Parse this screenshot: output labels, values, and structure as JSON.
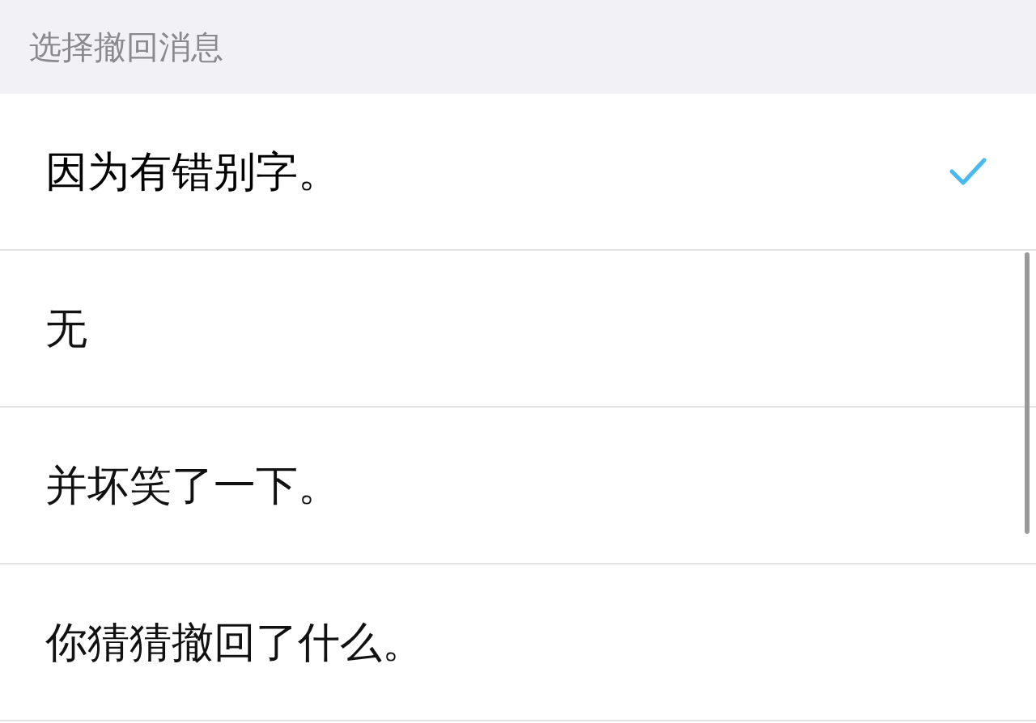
{
  "header": {
    "title": "选择撤回消息"
  },
  "options": [
    {
      "label": "因为有错别字。",
      "selected": true
    },
    {
      "label": "无",
      "selected": false
    },
    {
      "label": "并坏笑了一下。",
      "selected": false
    },
    {
      "label": "你猜猜撤回了什么。",
      "selected": false
    }
  ]
}
